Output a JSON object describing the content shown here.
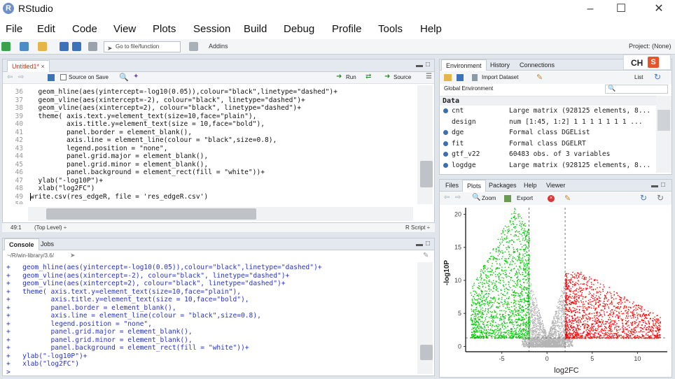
{
  "app": {
    "title": "RStudio",
    "logo_letter": "R"
  },
  "menu": [
    "File",
    "Edit",
    "Code",
    "View",
    "Plots",
    "Session",
    "Build",
    "Debug",
    "Profile",
    "Tools",
    "Help"
  ],
  "toolbar": {
    "goto_placeholder": "Go to file/function",
    "addins": "Addins",
    "project": "Project: (None)"
  },
  "editor": {
    "tab": "Untitled1*",
    "source_on_save": "Source on Save",
    "run": "Run",
    "source": "Source",
    "lines": [
      {
        "n": "36",
        "code": "  geom_hline(aes(yintercept=-log10(0.05)),colour=\"black\",linetype=\"dashed\")+"
      },
      {
        "n": "37",
        "code": "  geom_vline(aes(xintercept=-2), colour=\"black\", linetype=\"dashed\")+"
      },
      {
        "n": "38",
        "code": "  geom_vline(aes(xintercept=2), colour=\"black\", linetype=\"dashed\")+"
      },
      {
        "n": "39",
        "code": "  theme( axis.text.y=element_text(size=10,face=\"plain\"),"
      },
      {
        "n": "40",
        "code": "         axis.title.y=element_text(size = 10,face=\"bold\"),"
      },
      {
        "n": "41",
        "code": "         panel.border = element_blank(),"
      },
      {
        "n": "42",
        "code": "         axis.line = element_line(colour = \"black\",size=0.8),"
      },
      {
        "n": "43",
        "code": "         legend.position = \"none\","
      },
      {
        "n": "44",
        "code": "         panel.grid.major = element_blank(),"
      },
      {
        "n": "45",
        "code": "         panel.grid.minor = element_blank(),"
      },
      {
        "n": "46",
        "code": "         panel.background = element_rect(fill = \"white\"))+"
      },
      {
        "n": "47",
        "code": "  ylab(\"-log10P\")+"
      },
      {
        "n": "48",
        "code": "  xlab(\"log2FC\")"
      },
      {
        "n": "49",
        "code": "write.csv(res_edgeR, file = 'res_edgeR.csv')"
      },
      {
        "n": "50",
        "code": ""
      }
    ],
    "status_pos": "49:1",
    "status_level": "(Top Level) ÷",
    "status_type": "R Script ÷"
  },
  "console": {
    "tabs": [
      "Console",
      "Jobs"
    ],
    "path": "~/R/win-library/3.6/",
    "lines": [
      "+   geom_hline(aes(yintercept=-log10(0.05)),colour=\"black\",linetype=\"dashed\")+",
      "+   geom_vline(aes(xintercept=-2), colour=\"black\", linetype=\"dashed\")+",
      "+   geom_vline(aes(xintercept=2), colour=\"black\", linetype=\"dashed\")+",
      "+   theme( axis.text.y=element_text(size=10,face=\"plain\"),",
      "+          axis.title.y=element_text(size = 10,face=\"bold\"),",
      "+          panel.border = element_blank(),",
      "+          axis.line = element_line(colour = \"black\",size=0.8),",
      "+          legend.position = \"none\",",
      "+          panel.grid.major = element_blank(),",
      "+          panel.grid.minor = element_blank(),",
      "+          panel.background = element_rect(fill = \"white\"))+",
      "+   ylab(\"-log10P\")+",
      "+   xlab(\"log2FC\")",
      "> "
    ]
  },
  "environment": {
    "tabs": [
      "Environment",
      "History",
      "Connections"
    ],
    "import": "Import Dataset",
    "list": "List",
    "scope": "Global Environment",
    "section": "Data",
    "rows": [
      {
        "name": "cnt",
        "value": "Large matrix (928125 elements, 8..."
      },
      {
        "name": "design",
        "value": "num [1:45, 1:2] 1 1 1 1 1 1 1 ..."
      },
      {
        "name": "dge",
        "value": "Formal class DGEList"
      },
      {
        "name": "fit",
        "value": "Formal class DGELRT"
      },
      {
        "name": "gtf_v22",
        "value": "60483 obs. of 3 variables"
      },
      {
        "name": "logdge",
        "value": "Large matrix (928125 elements, 8..."
      }
    ],
    "ime": "CH"
  },
  "plots_pane": {
    "tabs": [
      "Files",
      "Plots",
      "Packages",
      "Help",
      "Viewer"
    ],
    "zoom": "Zoom",
    "export": "Export"
  },
  "colors": {
    "up": "#ff0000",
    "down": "#00c800",
    "ns": "#b4b4b4"
  },
  "chart_data": {
    "type": "scatter",
    "xlabel": "log2FC",
    "ylabel": "-log10P",
    "xticks": [
      -5,
      0,
      5,
      10
    ],
    "yticks": [
      0,
      5,
      10,
      15,
      20
    ],
    "xlim": [
      -9,
      13.3
    ],
    "ylim": [
      -0.8,
      21
    ],
    "vlines": [
      -2,
      2
    ],
    "hline": 1.3
  }
}
